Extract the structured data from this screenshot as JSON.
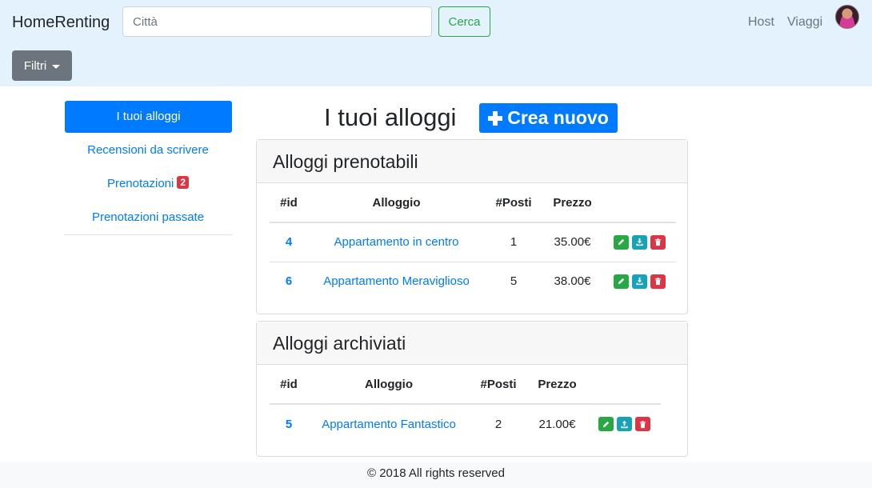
{
  "navbar": {
    "brand": "HomeRenting",
    "search_placeholder": "Città",
    "search_button": "Cerca",
    "links": {
      "host": "Host",
      "trips": "Viaggi"
    },
    "filters_button": "Filtri"
  },
  "sidebar": {
    "items": [
      {
        "label": "I tuoi alloggi",
        "active": true
      },
      {
        "label": "Recensioni da scrivere"
      },
      {
        "label": "Prenotazioni",
        "badge": "2"
      },
      {
        "label": "Prenotazioni passate"
      }
    ]
  },
  "main": {
    "title": "I tuoi alloggi",
    "create_button": "Crea nuovo",
    "bookable": {
      "header": "Alloggi prenotabili",
      "columns": [
        "#id",
        "Alloggio",
        "#Posti",
        "Prezzo"
      ],
      "rows": [
        {
          "id": "4",
          "name": "Appartamento in centro",
          "seats": "1",
          "price": "35.00€"
        },
        {
          "id": "6",
          "name": "Appartamento Meraviglioso",
          "seats": "5",
          "price": "38.00€"
        }
      ]
    },
    "archived": {
      "header": "Alloggi archiviati",
      "columns": [
        "#id",
        "Alloggio",
        "#Posti",
        "Prezzo"
      ],
      "rows": [
        {
          "id": "5",
          "name": "Appartamento Fantastico",
          "seats": "2",
          "price": "21.00€"
        }
      ]
    }
  },
  "footer": {
    "text": "© 2018 All rights reserved"
  },
  "colors": {
    "navbar_bg": "#e3f2fd",
    "primary": "#007bff",
    "success": "#28a745",
    "info": "#17a2b8",
    "danger": "#dc3545",
    "secondary": "#6c757d"
  }
}
